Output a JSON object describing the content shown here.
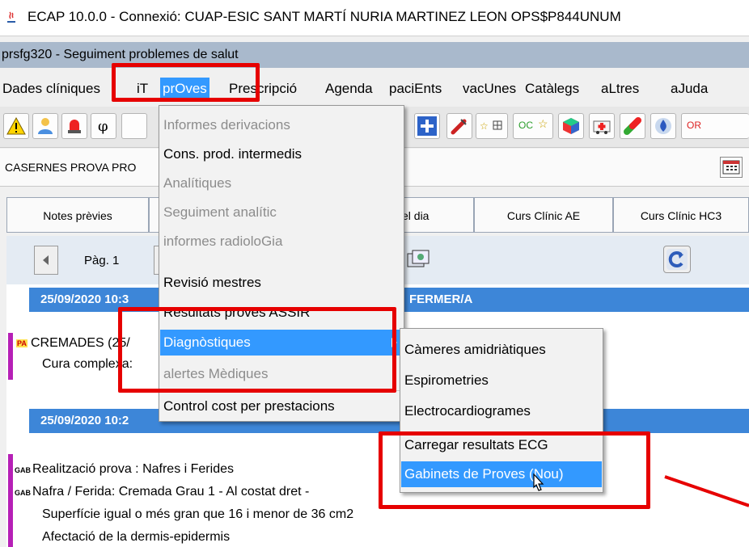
{
  "window": {
    "title": "ECAP 10.0.0 - Connexió: CUAP-ESIC SANT MARTÍ NURIA MARTINEZ LEON OPS$P844UNUM",
    "subtitle": "prsfg320 - Seguiment problemes de salut"
  },
  "menubar": [
    {
      "label": "Dades clíniques"
    },
    {
      "label": "iT"
    },
    {
      "label": "prOves"
    },
    {
      "label": "Prescripció"
    },
    {
      "label": "Agenda"
    },
    {
      "label": "paciEnts"
    },
    {
      "label": "vacUnes"
    },
    {
      "label": "Catàlegs"
    },
    {
      "label": "aLtres"
    },
    {
      "label": "aJuda"
    }
  ],
  "toolbar": {
    "oc_label": "OC",
    "or_label": "OR"
  },
  "infobar": {
    "location": "CASERNES PROVA PRO"
  },
  "tabs": [
    {
      "label": "Notes prèvies"
    },
    {
      "label": "el dia"
    },
    {
      "label": "Curs Clínic AE"
    },
    {
      "label": "Curs Clínic HC3"
    }
  ],
  "pager": {
    "label": "Pàg. 1"
  },
  "notes": {
    "header1_date": "25/09/2020 10:3",
    "header1_role": "FERMER/A",
    "header2_date": "25/09/2020 10:2",
    "pa_badge": "PA",
    "line1": "CREMADES (25/",
    "line2": "Cura complexa:",
    "gab_badge": "GAB",
    "gab1": "Realització prova : Nafres i Ferides",
    "gab2": "Nafra / Ferida:  Cremada Grau 1 - Al costat dret -",
    "gab3": "Superfície igual o més gran que 16 i menor de 36 cm2",
    "gab4": "Afectació de la dermis-epidermis"
  },
  "proves_menu": [
    {
      "label": "Informes derivacions",
      "enabled": false
    },
    {
      "label": "Cons. prod. intermedis",
      "enabled": true
    },
    {
      "label": "Analítiques",
      "enabled": false
    },
    {
      "label": "Seguiment analític",
      "enabled": false
    },
    {
      "label": "informes radioloGia",
      "enabled": false
    },
    {
      "label": "Revisió mestres",
      "enabled": true
    },
    {
      "label": "Resultats proves ASSIR",
      "enabled": true
    },
    {
      "label": "Diagnòstiques",
      "enabled": true,
      "highlighted": true,
      "submenu": true
    },
    {
      "label": "alertes Mèdiques",
      "enabled": false
    },
    {
      "label": "Control cost per prestacions",
      "enabled": true
    }
  ],
  "diagnostiques_submenu": [
    {
      "label": "Càmeres amidriàtiques"
    },
    {
      "label": "Espirometries"
    },
    {
      "label": "Electrocardiogrames"
    },
    {
      "label": "Carregar resultats ECG"
    },
    {
      "label": "Gabinets de Proves (Nou)",
      "highlighted": true
    }
  ],
  "colors": {
    "highlight": "#3399ff",
    "header_blue": "#3d86d8",
    "annotation_red": "#e60000"
  }
}
